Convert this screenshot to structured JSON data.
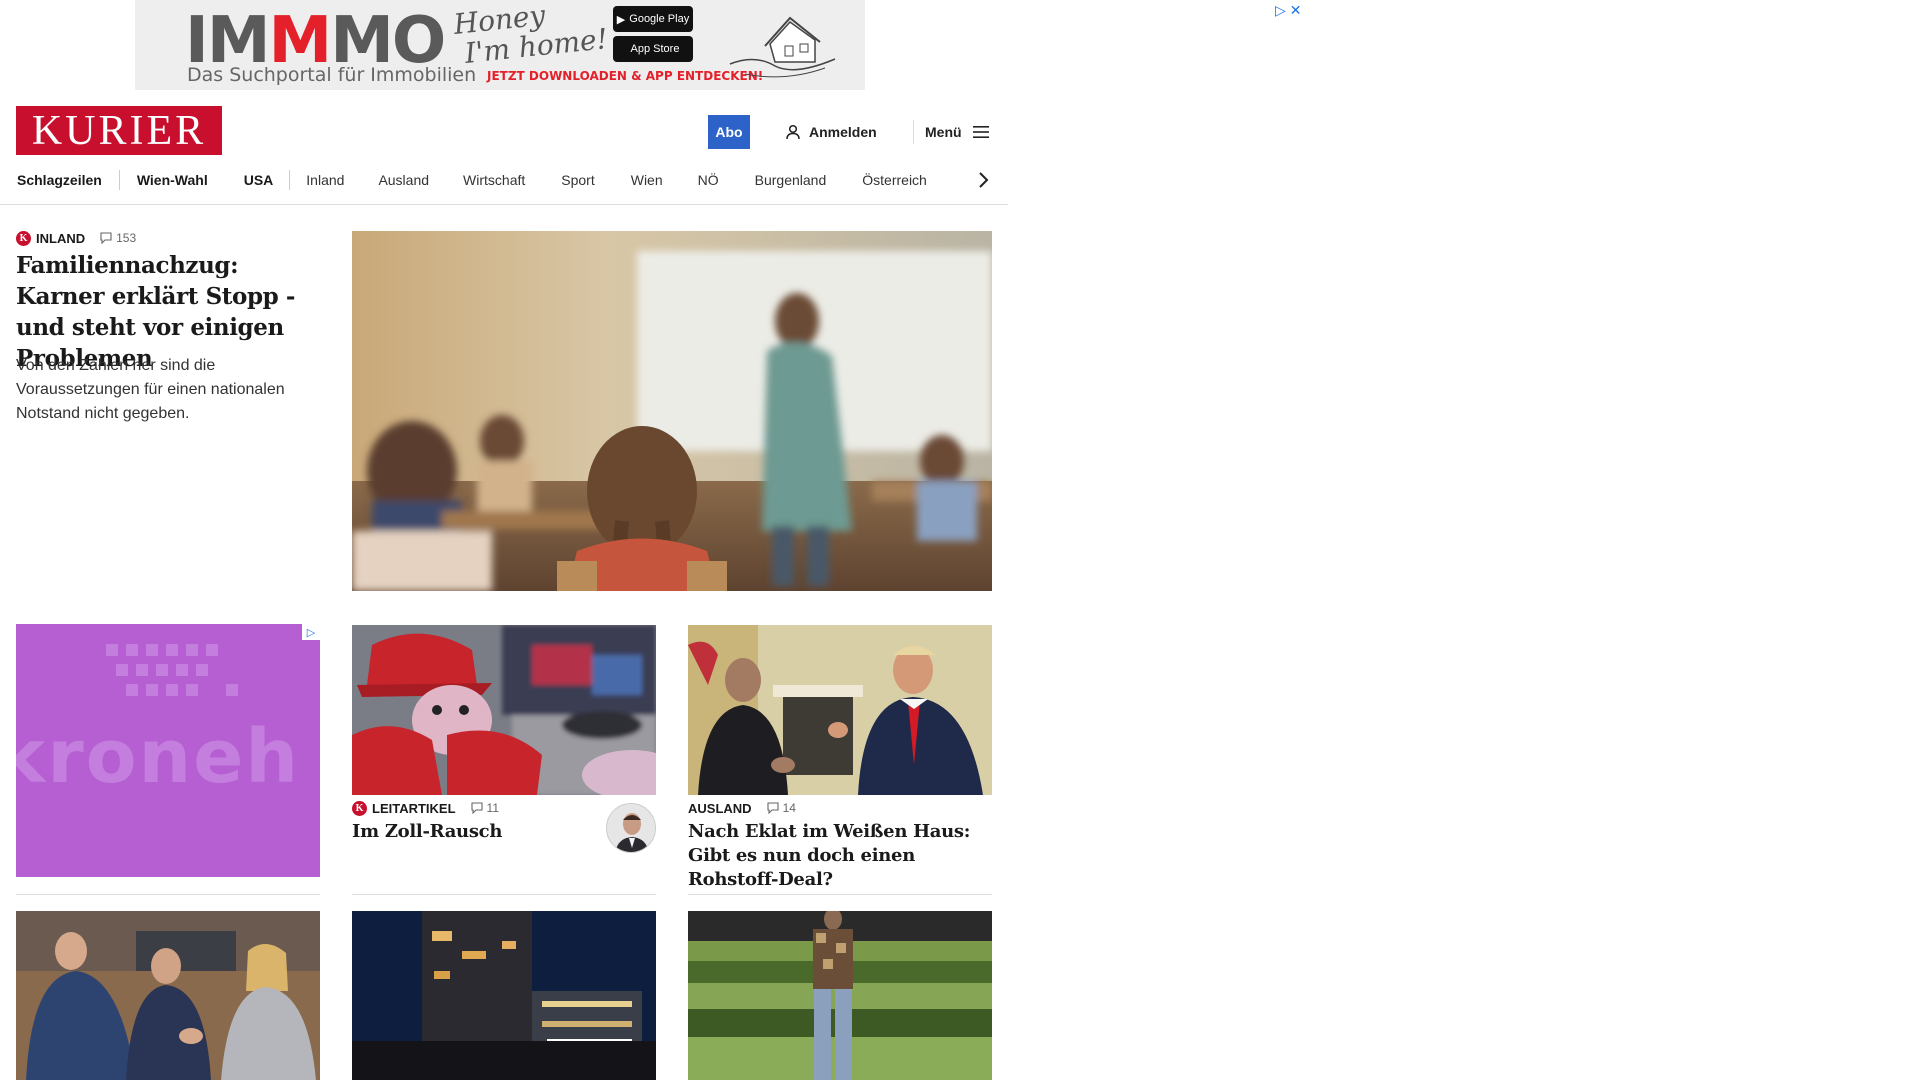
{
  "ad_banner": {
    "brand": "IMMMO",
    "brand_prefix": "IM",
    "brand_accent": "M",
    "brand_suffix": "MO",
    "tagline": "Das Suchportal für Immobilien",
    "script_line1": "Honey",
    "script_line2": "I'm home!",
    "store_google": "Google Play",
    "store_apple": "App Store",
    "cta": "JETZT DOWNLOADEN & APP ENTDECKEN!"
  },
  "header": {
    "logo": "KURIER",
    "abo_label": "Abo",
    "login_label": "Anmelden",
    "menu_label": "Menü"
  },
  "nav": {
    "items": [
      "Schlagzeilen",
      "Wien-Wahl",
      "USA",
      "Inland",
      "Ausland",
      "Wirtschaft",
      "Sport",
      "Wien",
      "NÖ",
      "Burgenland",
      "Österreich"
    ]
  },
  "lead": {
    "kicker": "INLAND",
    "comments": "153",
    "title": "Familiennachzug: Karner erklärt Stopp - und steht vor einigen Problemen",
    "teaser": "Von den Zahlen her sind die Voraussetzungen für einen nationalen Notstand nicht gegeben."
  },
  "ad_tile": {
    "text": "kroneh"
  },
  "cards": [
    {
      "kicker": "LEITARTIKEL",
      "comments": "11",
      "title": "Im Zoll-Rausch"
    },
    {
      "kicker": "AUSLAND",
      "comments": "14",
      "title": "Nach Eklat im Weißen Haus: Gibt es nun doch einen Rohstoff-Deal?"
    }
  ],
  "colors": {
    "brand": "#c8102e",
    "abo": "#2d63c8",
    "ad_purple": "#b65fd2"
  },
  "icons": {
    "user": "user-icon",
    "menu": "hamburger-icon",
    "chevron": "chevron-right-icon",
    "comment": "comment-icon",
    "adchoices": "adchoices-icon"
  }
}
